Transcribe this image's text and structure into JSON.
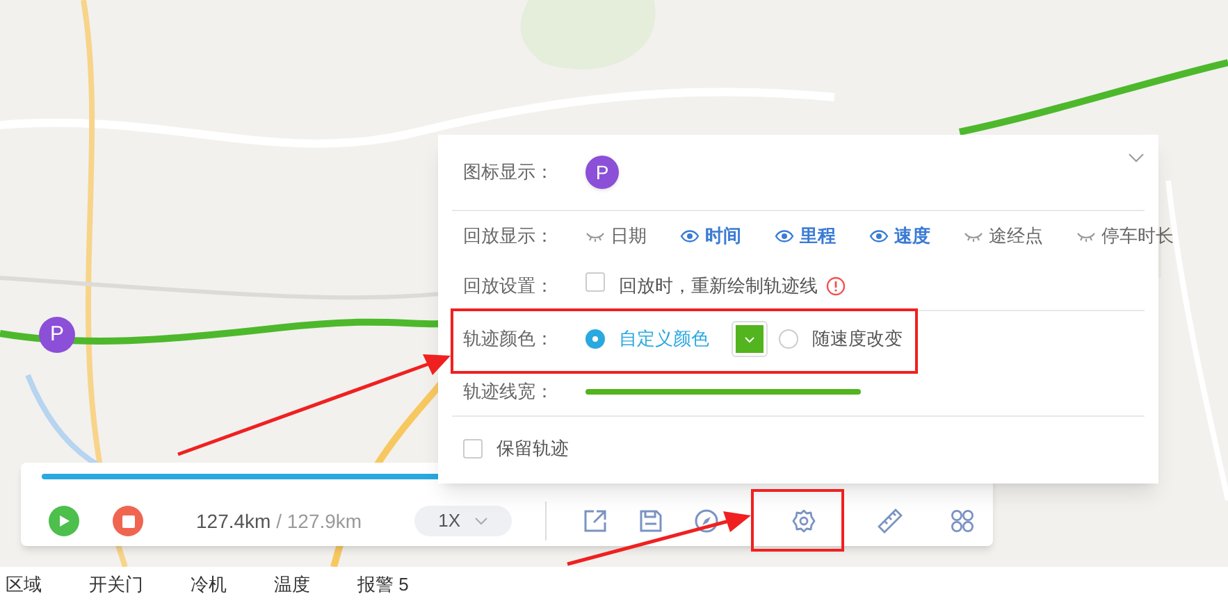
{
  "map": {
    "marker": {
      "label": "P"
    }
  },
  "playback": {
    "progress": {
      "level": 0.99
    },
    "distance_done": "127.4km",
    "distance_sep": " / ",
    "distance_total": "127.9km",
    "speed": "1X"
  },
  "settings": {
    "icon_row": {
      "label": "图标显示：",
      "icon_label": "P"
    },
    "display_row": {
      "label": "回放显示：",
      "options": [
        {
          "label": "日期",
          "on": false
        },
        {
          "label": "时间",
          "on": true
        },
        {
          "label": "里程",
          "on": true
        },
        {
          "label": "速度",
          "on": true
        },
        {
          "label": "途经点",
          "on": false
        },
        {
          "label": "停车时长",
          "on": false
        }
      ]
    },
    "replay_row": {
      "label": "回放设置：",
      "checkbox": {
        "label": "回放时，重新绘制轨迹线",
        "checked": false
      }
    },
    "color_row": {
      "label": "轨迹颜色：",
      "options": [
        {
          "label": "自定义颜色",
          "selected": true
        },
        {
          "label": "随速度改变",
          "selected": false
        }
      ]
    },
    "width_row": {
      "label": "轨迹线宽："
    },
    "keep_track": {
      "label": "保留轨迹",
      "checked": false
    }
  },
  "bottom_tabs": [
    {
      "label": "区域"
    },
    {
      "label": "开关门"
    },
    {
      "label": "冷机"
    },
    {
      "label": "温度"
    },
    {
      "label": "报警 5"
    }
  ]
}
